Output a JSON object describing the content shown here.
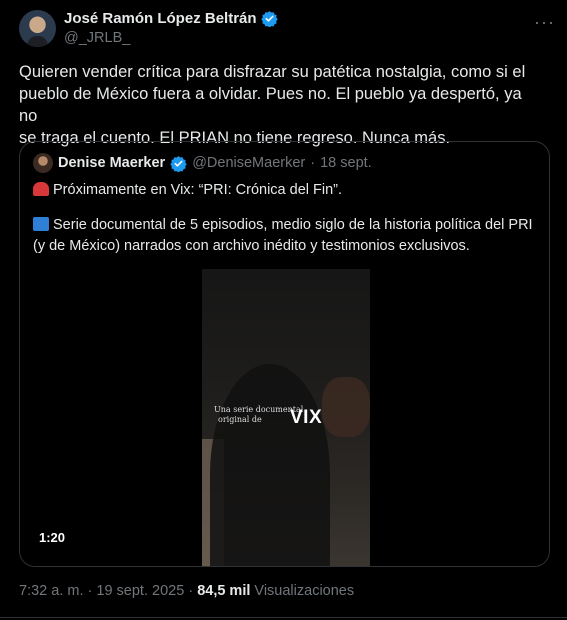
{
  "author": {
    "name": "José Ramón López Beltrán",
    "handle": "@_JRLB_"
  },
  "more_label": "···",
  "tweet": {
    "lines": [
      "Quieren vender crítica para disfrazar su patética nostalgia, como si el",
      "pueblo de México fuera a olvidar. Pues no. El pueblo ya despertó, ya no",
      "se traga el cuento. El PRIAN no tiene regreso. Nunca más."
    ]
  },
  "quote": {
    "name": "Denise Maerker",
    "handle": "@DeniseMaerker",
    "separator": "·",
    "date": "18 sept.",
    "line1": "Próximamente en Vix: “PRI: Crónica del Fin”.",
    "line2": "Serie documental de 5 episodios, medio siglo de la historia política del PRI",
    "line3": "(y de México) narrados con archivo inédito y testimonios exclusivos.",
    "line1_icon": "siren-emoji",
    "line2_icon": "tv-emoji",
    "video": {
      "overlay_line1": "Una serie documental",
      "overlay_line2": "original de",
      "logo": "VIX",
      "duration": "1:20"
    }
  },
  "footer": {
    "time": "7:32 a. m.",
    "dot1": "·",
    "date": "19 sept. 2025",
    "dot2": "·",
    "views": "84,5 mil",
    "views_label": "Visualizaciones"
  },
  "colors": {
    "background": "#000000",
    "text": "#e7e9ea",
    "muted": "#71767b",
    "verified": "#1d9bf0",
    "border": "#2f3336"
  }
}
